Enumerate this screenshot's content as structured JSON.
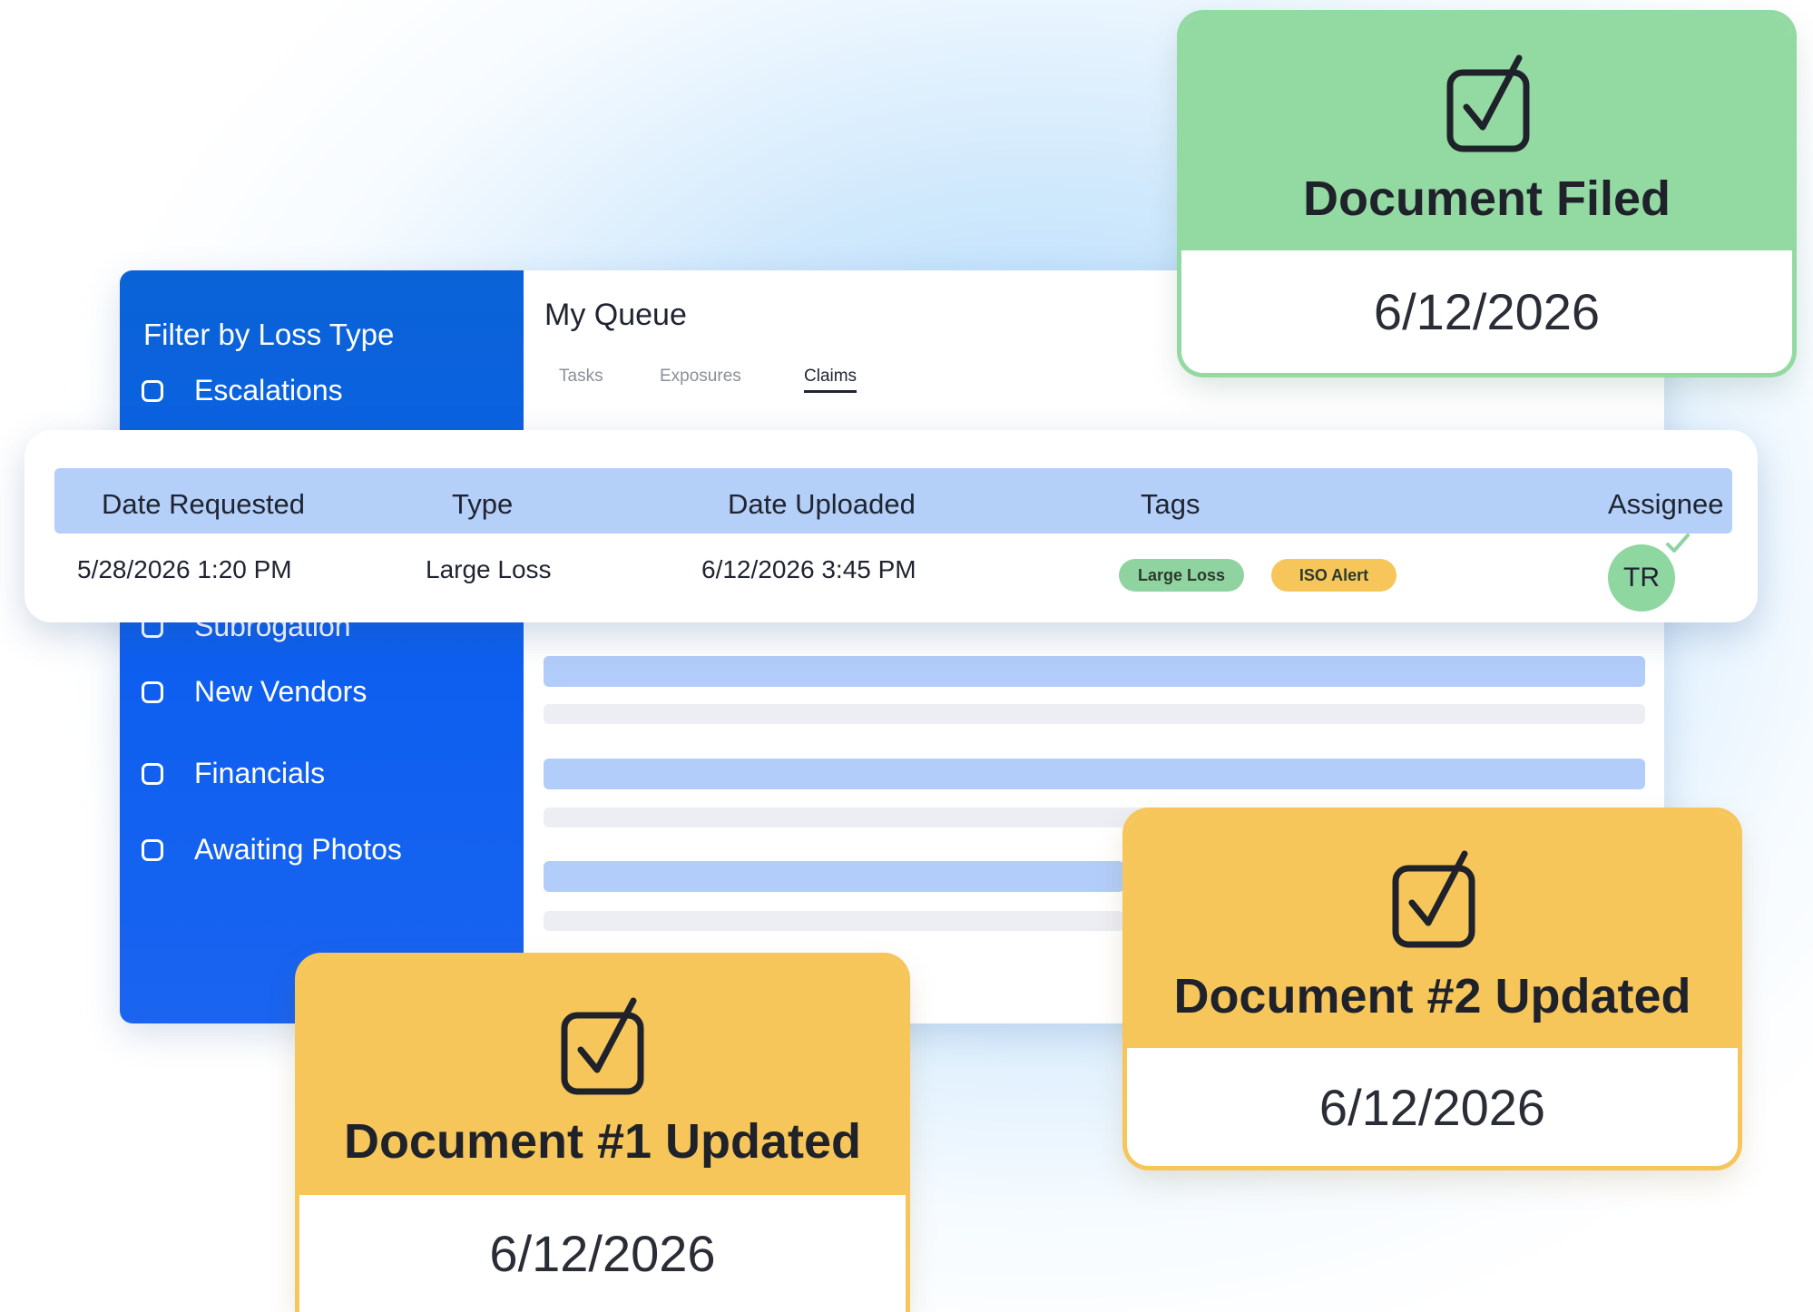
{
  "sidebar": {
    "title": "Filter by Loss Type",
    "items": [
      {
        "label": "Escalations"
      },
      {
        "label": "Subrogation"
      },
      {
        "label": "New Vendors"
      },
      {
        "label": "Financials"
      },
      {
        "label": "Awaiting Photos"
      }
    ]
  },
  "queue": {
    "title": "My Queue",
    "tabs": [
      {
        "label": "Tasks"
      },
      {
        "label": "Exposures"
      },
      {
        "label": "Claims",
        "active": true
      }
    ]
  },
  "table": {
    "columns": [
      "Date Requested",
      "Type",
      "Date Uploaded",
      "Tags",
      "Assignee"
    ],
    "row": {
      "date_requested": "5/28/2026 1:20 PM",
      "type": "Large Loss",
      "date_uploaded": "6/12/2026 3:45 PM",
      "tags": [
        {
          "label": "Large Loss",
          "color": "#8fd4a0"
        },
        {
          "label": "ISO Alert",
          "color": "#f6c65b"
        }
      ],
      "assignee": "TR"
    }
  },
  "notifications": [
    {
      "title": "Document Filed",
      "date": "6/12/2026",
      "color": "#93d9a2",
      "icon": "check-square-icon"
    },
    {
      "title": "Document #2 Updated",
      "date": "6/12/2026",
      "color": "#f6c65b",
      "icon": "check-square-icon"
    },
    {
      "title": "Document #1 Updated",
      "date": "6/12/2026",
      "color": "#f6c65b",
      "icon": "check-square-icon"
    }
  ],
  "colors": {
    "sidebar_blue": "#0e5ff0",
    "table_header": "#b4cff8",
    "success_green": "#93d9a2",
    "warning_yellow": "#f6c65b"
  }
}
